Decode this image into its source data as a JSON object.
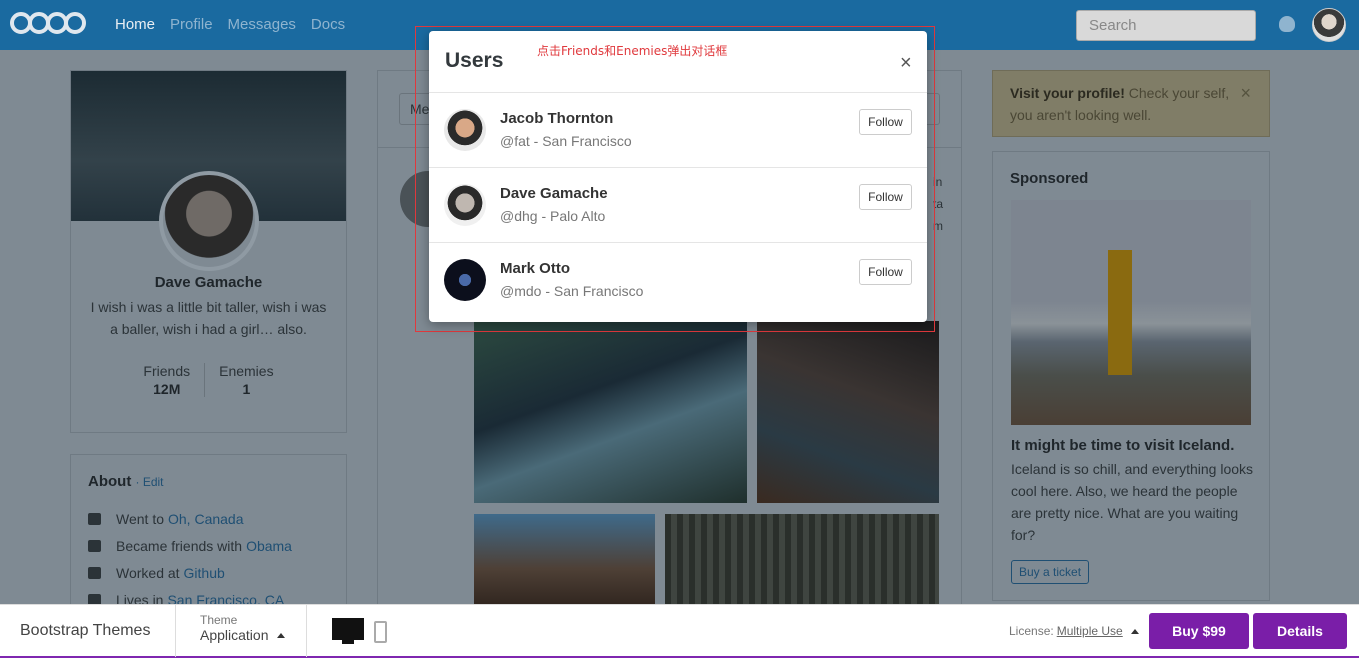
{
  "navbar": {
    "links": [
      "Home",
      "Profile",
      "Messages",
      "Docs"
    ],
    "search_placeholder": "Search"
  },
  "profile": {
    "name": "Dave Gamache",
    "bio": "I wish i was a little bit taller, wish i was a baller, wish i had a girl… also.",
    "friends_label": "Friends",
    "friends_value": "12M",
    "enemies_label": "Enemies",
    "enemies_value": "1"
  },
  "about": {
    "title": "About",
    "edit": "· Edit",
    "items": [
      {
        "icon": "calendar-icon",
        "text": "Went to",
        "link": "Oh, Canada"
      },
      {
        "icon": "users-icon",
        "text": "Became friends with",
        "link": "Obama"
      },
      {
        "icon": "github-icon",
        "text": "Worked at",
        "link": "Github"
      },
      {
        "icon": "home-icon",
        "text": "Lives in",
        "link": "San Francisco, CA"
      }
    ]
  },
  "feed": {
    "input_placeholder": "Me",
    "side_text": [
      "in",
      "ta",
      "m"
    ]
  },
  "alert": {
    "bold": "Visit your profile!",
    "text": "Check your self, you aren't looking well.",
    "close": "×"
  },
  "sponsor": {
    "title": "Sponsored",
    "headline": "It might be time to visit Iceland.",
    "body": "Iceland is so chill, and everything looks cool here. Also, we heard the people are pretty nice. What are you waiting for?",
    "button": "Buy a ticket"
  },
  "modal": {
    "title": "Users",
    "close": "×",
    "annotation": "点击Friends和Enemies弹出对话框",
    "users": [
      {
        "name": "Jacob Thornton",
        "handle": "@fat - San Francisco",
        "button": "Follow"
      },
      {
        "name": "Dave Gamache",
        "handle": "@dhg - Palo Alto",
        "button": "Follow"
      },
      {
        "name": "Mark Otto",
        "handle": "@mdo - San Francisco",
        "button": "Follow"
      }
    ]
  },
  "bottom_bar": {
    "brand": "Bootstrap Themes",
    "theme_label": "Theme",
    "theme_value": "Application",
    "license_label": "License:",
    "license_value": "Multiple Use",
    "buy": "Buy $99",
    "details": "Details"
  },
  "colors": {
    "navbar": "#1a6aa0",
    "accent_purple": "#7a1ea8",
    "annotation_red": "#e0393d"
  }
}
